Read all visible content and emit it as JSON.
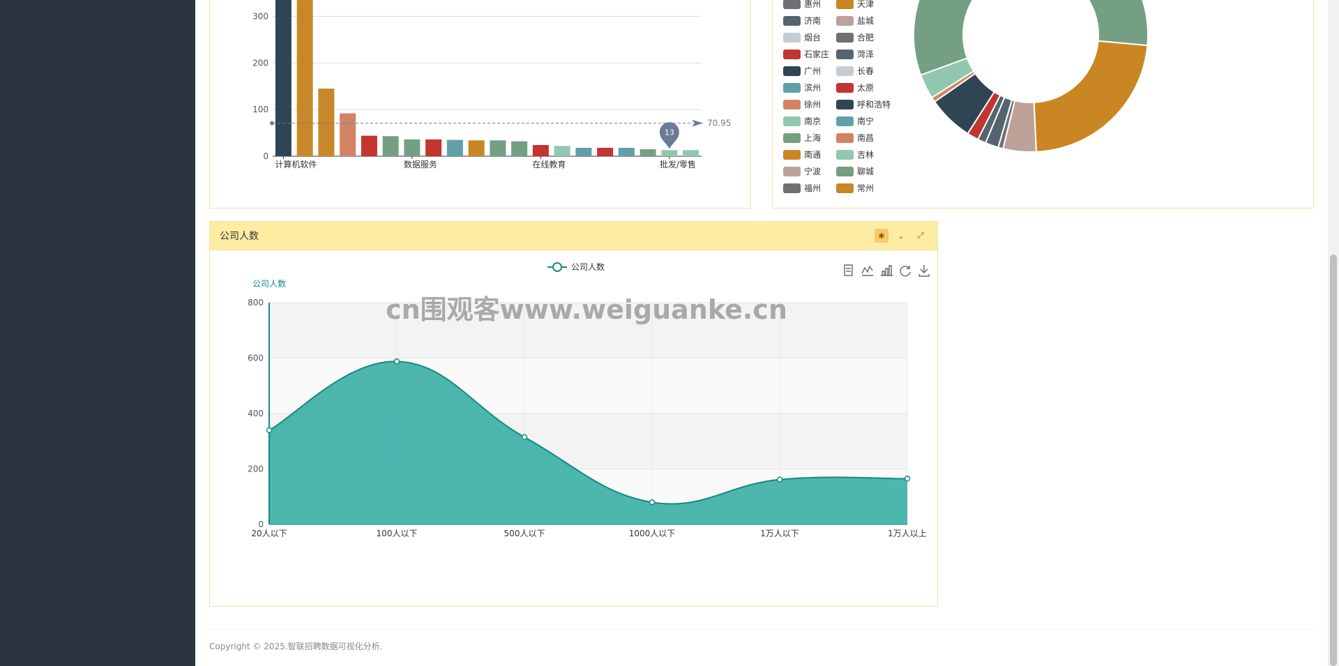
{
  "bar_panel": {
    "chart_data": {
      "type": "bar",
      "ylim": [
        0,
        350
      ],
      "yticks": [
        0,
        100,
        200,
        300
      ],
      "xlabels_shown": [
        "计算机软件",
        "数据服务",
        "在线教育",
        "批发/零售"
      ],
      "values": [
        350,
        350,
        145,
        92,
        44,
        43,
        36,
        36,
        35,
        34,
        34,
        32,
        24,
        22,
        18,
        18,
        18,
        15,
        13,
        13
      ],
      "bar_colors": [
        "#2f4554",
        "#c8882a",
        "#c8882a",
        "#d48265",
        "#c23531",
        "#749f83",
        "#749f83",
        "#c23531",
        "#61a0a8",
        "#ca8622",
        "#749f83",
        "#749f83",
        "#c23531",
        "#91c7ae",
        "#61a0a8",
        "#c23531",
        "#61a0a8",
        "#749f83",
        "#91c7ae",
        "#91c7ae"
      ],
      "mark_line": {
        "value": 70.95,
        "label": "70.95"
      },
      "mark_point": {
        "value": 13,
        "label": "13",
        "index": 18
      }
    }
  },
  "pie_panel": {
    "legend": [
      {
        "name": "惠州",
        "color": "#6e7074"
      },
      {
        "name": "天津",
        "color": "#ca8622"
      },
      {
        "name": "济南",
        "color": "#546570"
      },
      {
        "name": "盐城",
        "color": "#bda29a"
      },
      {
        "name": "烟台",
        "color": "#c4ccd3"
      },
      {
        "name": "合肥",
        "color": "#6e7074"
      },
      {
        "name": "石家庄",
        "color": "#c23531"
      },
      {
        "name": "菏泽",
        "color": "#546570"
      },
      {
        "name": "广州",
        "color": "#2f4554"
      },
      {
        "name": "长春",
        "color": "#c4ccd3"
      },
      {
        "name": "滨州",
        "color": "#61a0a8"
      },
      {
        "name": "太原",
        "color": "#c23531"
      },
      {
        "name": "徐州",
        "color": "#d48265"
      },
      {
        "name": "呼和浩特",
        "color": "#2f4554"
      },
      {
        "name": "南京",
        "color": "#91c7ae"
      },
      {
        "name": "南宁",
        "color": "#61a0a8"
      },
      {
        "name": "上海",
        "color": "#749f83"
      },
      {
        "name": "南昌",
        "color": "#d48265"
      },
      {
        "name": "南通",
        "color": "#ca8622"
      },
      {
        "name": "吉林",
        "color": "#91c7ae"
      },
      {
        "name": "宁波",
        "color": "#bda29a"
      },
      {
        "name": "聊城",
        "color": "#749f83"
      },
      {
        "name": "福州",
        "color": "#6e7074"
      },
      {
        "name": "常州",
        "color": "#ca8622"
      }
    ],
    "chart_data": {
      "type": "pie",
      "slices": [
        {
          "value": 4,
          "color": "#d48265"
        },
        {
          "value": 3,
          "color": "#91c7ae"
        },
        {
          "value": 12,
          "color": "#749f83"
        },
        {
          "value": 20,
          "color": "#ca8622"
        },
        {
          "value": 4,
          "color": "#bda29a"
        },
        {
          "value": 0.6,
          "color": "#6e7074"
        },
        {
          "value": 1.6,
          "color": "#546570"
        },
        {
          "value": 1,
          "color": "#546570"
        },
        {
          "value": 1.4,
          "color": "#c23531"
        },
        {
          "value": 5.5,
          "color": "#2f4554"
        },
        {
          "value": 0.6,
          "color": "#d48265"
        },
        {
          "value": 3,
          "color": "#91c7ae"
        },
        {
          "value": 30,
          "color": "#749f83"
        },
        {
          "value": 1,
          "color": "#bda29a"
        }
      ]
    }
  },
  "area_panel": {
    "title": "公司人数",
    "legend_label": "公司人数",
    "watermark": "cn围观客www.weiguanke.cn",
    "chart_data": {
      "type": "area",
      "categories": [
        "20人以下",
        "100人以下",
        "500人以下",
        "1000人以下",
        "1万人以下",
        "1万人以上"
      ],
      "series": [
        {
          "name": "公司人数",
          "values": [
            340,
            588,
            315,
            80,
            162,
            165
          ]
        }
      ],
      "ylabel": "公司人数",
      "ylim": [
        0,
        800
      ],
      "yticks": [
        0,
        200,
        400,
        600,
        800
      ],
      "line_color": "#138a80",
      "fill_color": "#3aaea4"
    }
  },
  "footer": {
    "text": "Copyright © 2025.智联招聘数据可视化分析."
  }
}
